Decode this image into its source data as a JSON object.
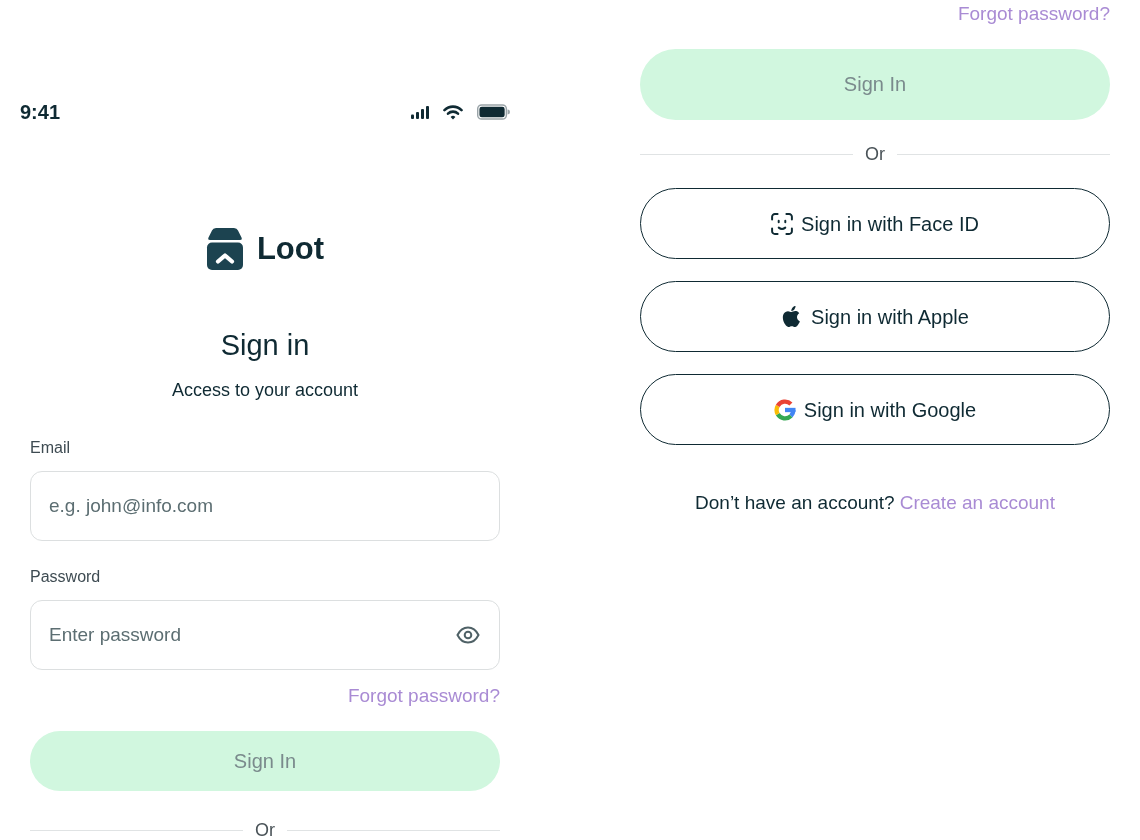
{
  "left_panel": {
    "status_bar": {
      "time": "9:41"
    },
    "logo": {
      "name": "Loot"
    },
    "title": "Sign in",
    "subtitle": "Access to your account",
    "fields": [
      {
        "kind": "email",
        "label": "Email",
        "placeholder": "e.g. john@info.com"
      },
      {
        "kind": "password",
        "label": "Password",
        "placeholder": "Enter password"
      }
    ],
    "forgot_password_link": "Forgot password?",
    "sign_in_button": {
      "label": "Sign In",
      "disabled": true
    },
    "divider_label": "Or"
  },
  "right_panel": {
    "forgot_password_link": "Forgot password?",
    "sign_in_button": {
      "label": "Sign In",
      "disabled": true
    },
    "divider_label": "Or",
    "social_buttons": [
      {
        "kind": "face_id",
        "label": "Sign in with Face ID"
      },
      {
        "kind": "apple",
        "label": "Sign in with Apple"
      },
      {
        "kind": "google",
        "label": "Sign in with Google"
      }
    ],
    "footer": {
      "prompt": "Don’t have an account?",
      "link": "Create an account"
    }
  }
}
